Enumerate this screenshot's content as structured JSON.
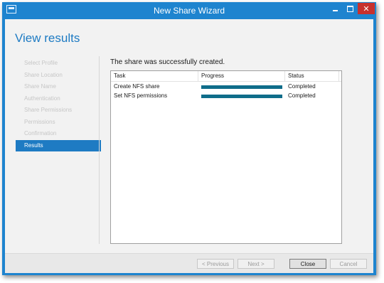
{
  "window": {
    "title": "New Share Wizard",
    "minimize_label": "minimize",
    "maximize_label": "maximize",
    "close_glyph": "✕"
  },
  "page": {
    "heading": "View results",
    "success_message": "The share was successfully created."
  },
  "sidebar": {
    "items": [
      {
        "label": "Select Profile",
        "active": false
      },
      {
        "label": "Share Location",
        "active": false
      },
      {
        "label": "Share Name",
        "active": false
      },
      {
        "label": "Authentication",
        "active": false
      },
      {
        "label": "Share Permissions",
        "active": false
      },
      {
        "label": "Permissions",
        "active": false
      },
      {
        "label": "Confirmation",
        "active": false
      },
      {
        "label": "Results",
        "active": true
      }
    ]
  },
  "results_table": {
    "columns": [
      "Task",
      "Progress",
      "Status"
    ],
    "rows": [
      {
        "task": "Create NFS share",
        "progress": 1.0,
        "status": "Completed"
      },
      {
        "task": "Set NFS permissions",
        "progress": 1.0,
        "status": "Completed"
      }
    ]
  },
  "footer": {
    "previous": "< Previous",
    "next": "Next >",
    "close": "Close",
    "cancel": "Cancel"
  },
  "colors": {
    "title_bar": "#1e84cf",
    "accent": "#1e7bc3",
    "progress_fill": "#0f6d8a",
    "close_button": "#c7312e"
  }
}
